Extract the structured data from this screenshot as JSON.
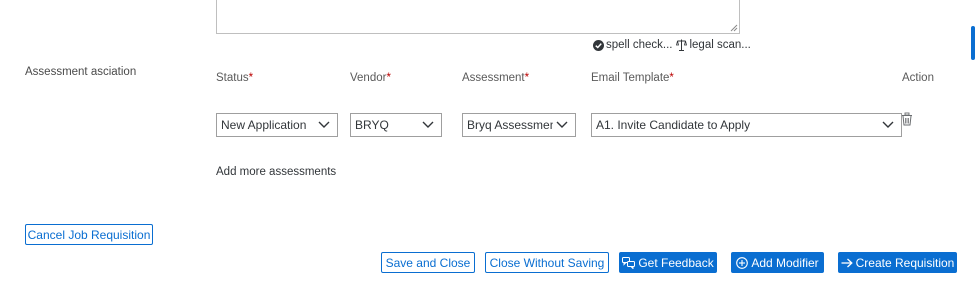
{
  "editor": {
    "spell_check_label": "spell check...",
    "legal_scan_label": "legal scan..."
  },
  "section": {
    "label": "Assessment asciation"
  },
  "columns": {
    "status": "Status",
    "vendor": "Vendor",
    "assessment": "Assessment",
    "email_template": "Email Template",
    "action": "Action",
    "required_marker": "*"
  },
  "row": {
    "status": "New Application",
    "vendor": "BRYQ",
    "assessment": "Bryq Assessment",
    "email_template": "A1. Invite Candidate to Apply"
  },
  "add_more_label": "Add more assessments",
  "buttons": {
    "cancel": "Cancel Job Requisition",
    "save_close": "Save and Close",
    "close_without_saving": "Close Without Saving",
    "get_feedback": "Get Feedback",
    "add_modifier": "Add Modifier",
    "create_requisition": "Create Requisition"
  },
  "colors": {
    "accent": "#0a6ed1",
    "required": "#bb0000"
  },
  "icons": [
    "check-circle-icon",
    "legal-scan-icon",
    "chevron-down-icon",
    "trash-icon",
    "feedback-icon",
    "add-circle-icon",
    "arrow-right-icon"
  ]
}
